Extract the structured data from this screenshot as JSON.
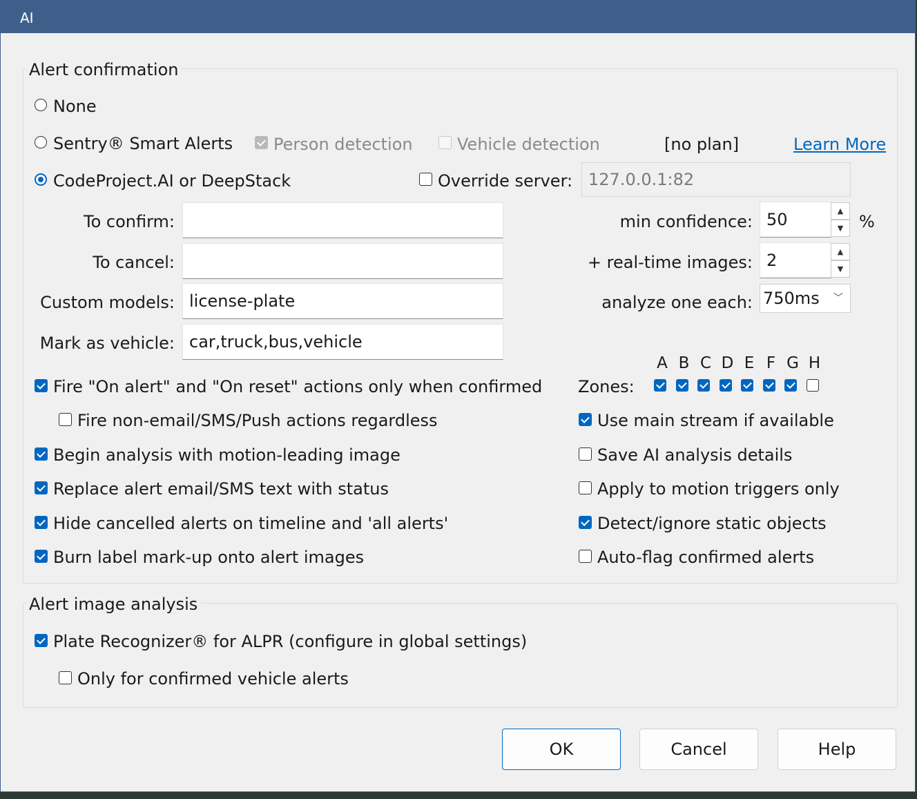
{
  "window": {
    "title": "AI"
  },
  "alert_confirmation": {
    "group_label": "Alert confirmation",
    "radio_none": "None",
    "radio_sentry": "Sentry® Smart Alerts",
    "person_detection": "Person detection",
    "vehicle_detection": "Vehicle detection",
    "plan_status": "[no plan]",
    "learn_more": "Learn More",
    "radio_codeproject": "CodeProject.AI or DeepStack",
    "selected_engine": "CodeProject.AI or DeepStack",
    "override_server_label": "Override server:",
    "override_server_value": "127.0.0.1:82",
    "to_confirm_label": "To confirm:",
    "to_confirm_value": "",
    "to_cancel_label": "To cancel:",
    "to_cancel_value": "",
    "custom_models_label": "Custom models:",
    "custom_models_value": "license-plate",
    "mark_vehicle_label": "Mark as vehicle:",
    "mark_vehicle_value": "car,truck,bus,vehicle",
    "min_confidence_label": "min confidence:",
    "min_confidence_value": "50",
    "percent": "%",
    "realtime_label": "+ real-time images:",
    "realtime_value": "2",
    "analyze_label": "analyze one each:",
    "analyze_value": "750ms",
    "zones_label": "Zones:",
    "zones": [
      {
        "letter": "A",
        "checked": true
      },
      {
        "letter": "B",
        "checked": true
      },
      {
        "letter": "C",
        "checked": true
      },
      {
        "letter": "D",
        "checked": true
      },
      {
        "letter": "E",
        "checked": true
      },
      {
        "letter": "F",
        "checked": true
      },
      {
        "letter": "G",
        "checked": true
      },
      {
        "letter": "H",
        "checked": false
      }
    ],
    "options_left": [
      {
        "label": "Fire \"On alert\" and \"On reset\" actions only when confirmed",
        "checked": true
      },
      {
        "label": "Fire non-email/SMS/Push actions regardless",
        "checked": false
      },
      {
        "label": "Begin analysis with motion-leading image",
        "checked": true
      },
      {
        "label": "Replace alert email/SMS text with status",
        "checked": true
      },
      {
        "label": "Hide cancelled alerts on timeline and  'all alerts'",
        "checked": true
      },
      {
        "label": "Burn label mark-up onto alert images",
        "checked": true
      }
    ],
    "options_right": [
      {
        "label": "Use main stream if available",
        "checked": true
      },
      {
        "label": "Save AI analysis details",
        "checked": false
      },
      {
        "label": "Apply to motion triggers only",
        "checked": false
      },
      {
        "label": "Detect/ignore static objects",
        "checked": true
      },
      {
        "label": "Auto-flag confirmed alerts",
        "checked": false
      }
    ]
  },
  "alert_image_analysis": {
    "group_label": "Alert image analysis",
    "plate_recognizer": "Plate Recognizer® for ALPR (configure in global settings)",
    "only_confirmed": "Only for confirmed vehicle alerts"
  },
  "buttons": {
    "ok": "OK",
    "cancel": "Cancel",
    "help": "Help"
  },
  "colors": {
    "titlebar": "#3e5f8a",
    "accent": "#0067c0",
    "dialog_bg": "#f0f0f0"
  }
}
